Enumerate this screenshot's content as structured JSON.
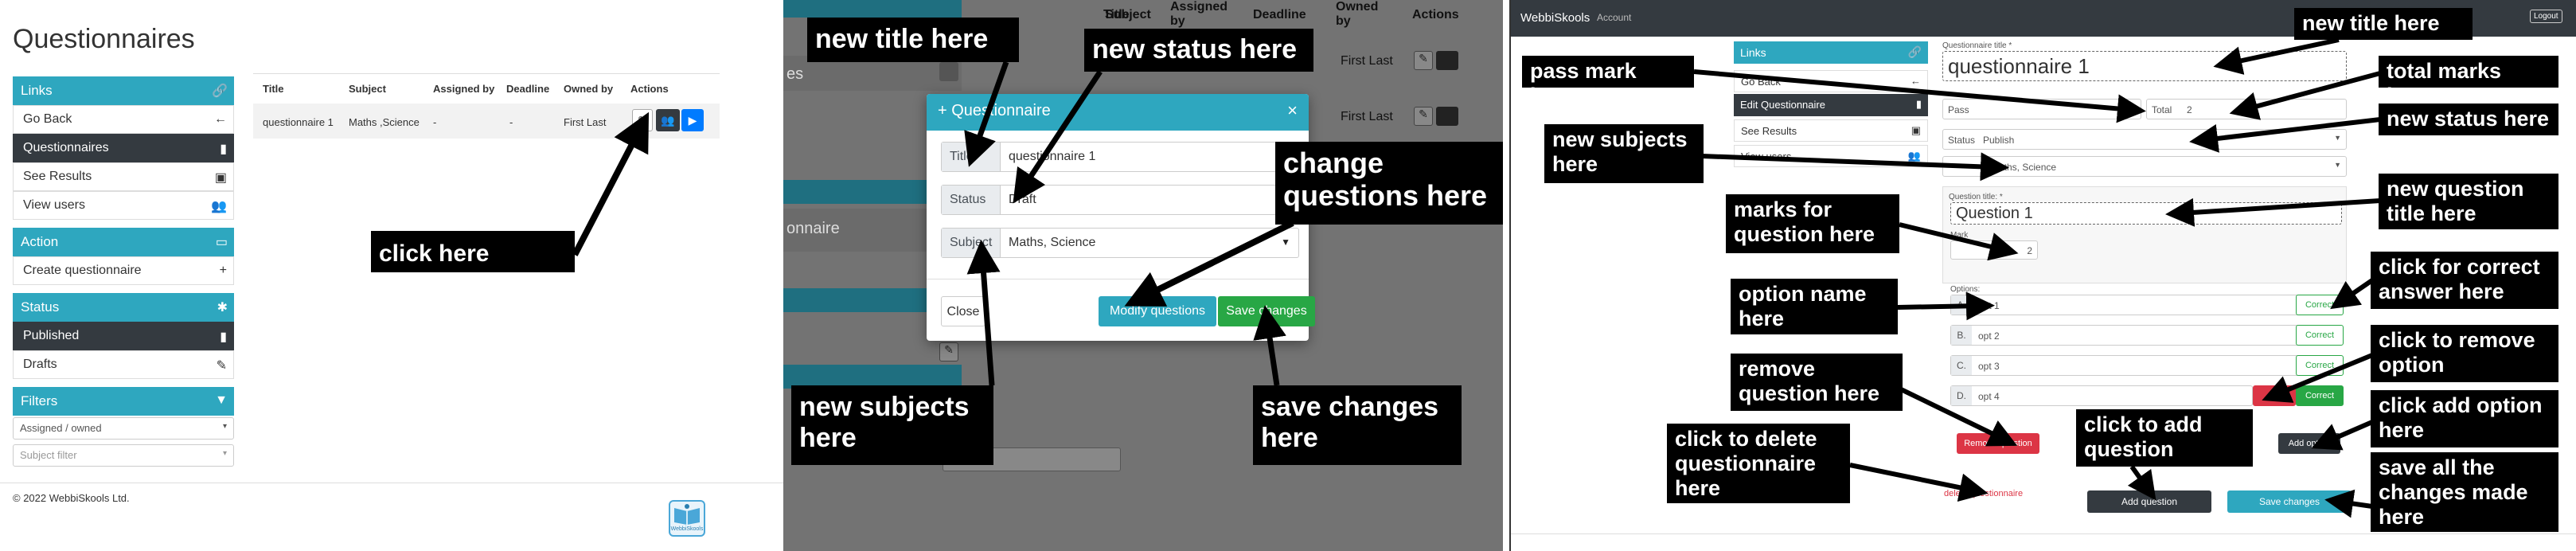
{
  "panel1": {
    "page_title": "Questionnaires",
    "sidebar": {
      "links_header": "Links",
      "links": [
        "Go Back",
        "Questionnaires",
        "See Results",
        "View users"
      ],
      "action_header": "Action",
      "actions": [
        "Create questionnaire"
      ],
      "status_header": "Status",
      "statuses": [
        "Published",
        "Drafts"
      ],
      "filters_header": "Filters",
      "filter_assigned": "Assigned / owned",
      "filter_subject_placeholder": "Subject filter"
    },
    "table": {
      "headers": [
        "Title",
        "Subject",
        "Assigned by",
        "Deadline",
        "Owned by",
        "Actions"
      ],
      "row": [
        "questionnaire 1",
        "Maths ,Science",
        "-",
        "-",
        "First Last"
      ]
    },
    "footer": "© 2022 WebbiSkools Ltd.",
    "logo_text": "WebbiSkools",
    "callout": "click here"
  },
  "panel2": {
    "bg_headers": [
      "Title",
      "Subject",
      "Assigned by",
      "Deadline",
      "Owned by",
      "Actions"
    ],
    "bg_rows": [
      "First Last",
      "First Last"
    ],
    "bg_snippets": [
      "es",
      "onnaire"
    ],
    "modal": {
      "title": "Questionnaire",
      "fields": [
        {
          "label": "Title",
          "value": "questionnaire 1"
        },
        {
          "label": "Status",
          "value": "Draft"
        },
        {
          "label": "Subject",
          "value": "Maths, Science"
        }
      ],
      "close": "Close",
      "modify": "Modify questions",
      "save": "Save changes"
    },
    "callouts": {
      "title": "new title here",
      "status": "new status here",
      "questions": "change questions here",
      "subjects": "new subjects here",
      "save": "save changes here"
    }
  },
  "panel3": {
    "nav": {
      "brand": "WebbiSkools",
      "account": "Account",
      "logout": "Logout"
    },
    "sidebar": {
      "header": "Links",
      "items": [
        "Go Back",
        "Edit Questionnaire",
        "See Results",
        "View users"
      ]
    },
    "form": {
      "title_label": "Questionnaire title *",
      "title_value": "questionnaire 1",
      "pass_label": "Pass",
      "pass_value": "0",
      "total_label": "Total",
      "total_value": "2",
      "status_label": "Status",
      "status_value": "Publish",
      "subject_value": "Maths, Science",
      "question_label": "Question title: *",
      "question_value": "Question 1",
      "mark_label": "Mark",
      "mark_value": "2",
      "options_label": "Options:",
      "options": [
        {
          "letter": "A.",
          "text": "opt 1",
          "btn": "Correct"
        },
        {
          "letter": "B.",
          "text": "opt 2",
          "btn": "Correct"
        },
        {
          "letter": "C.",
          "text": "opt 3",
          "btn": "Correct"
        },
        {
          "letter": "D.",
          "text": "opt 4",
          "btn": "Correct",
          "remove": "R"
        }
      ],
      "remove_question": "Remove question",
      "add_option": "Add option",
      "delete_questionnaire": "delete questionnaire",
      "add_question": "Add question",
      "save_changes": "Save changes"
    },
    "callouts": {
      "new_title": "new title here",
      "pass_mark": "pass mark here",
      "total_marks": "total marks here",
      "new_status": "new status here",
      "new_subjects": "new subjects here",
      "new_question_title": "new question title here",
      "marks_for_question": "marks for question here",
      "correct_answer": "click for correct answer here",
      "option_name": "option name here",
      "remove_option": "click to remove option",
      "remove_question": "remove question here",
      "add_option": "click add option here",
      "delete_questionnaire": "click to delete questionnaire here",
      "add_question": "click to add question",
      "save_all": "save all the changes made here"
    }
  },
  "colors": {
    "accent": "#2ea7bf",
    "dark": "#343a40",
    "primary": "#007bff",
    "success": "#28a745",
    "danger": "#dc3545",
    "callout": "#000000"
  }
}
